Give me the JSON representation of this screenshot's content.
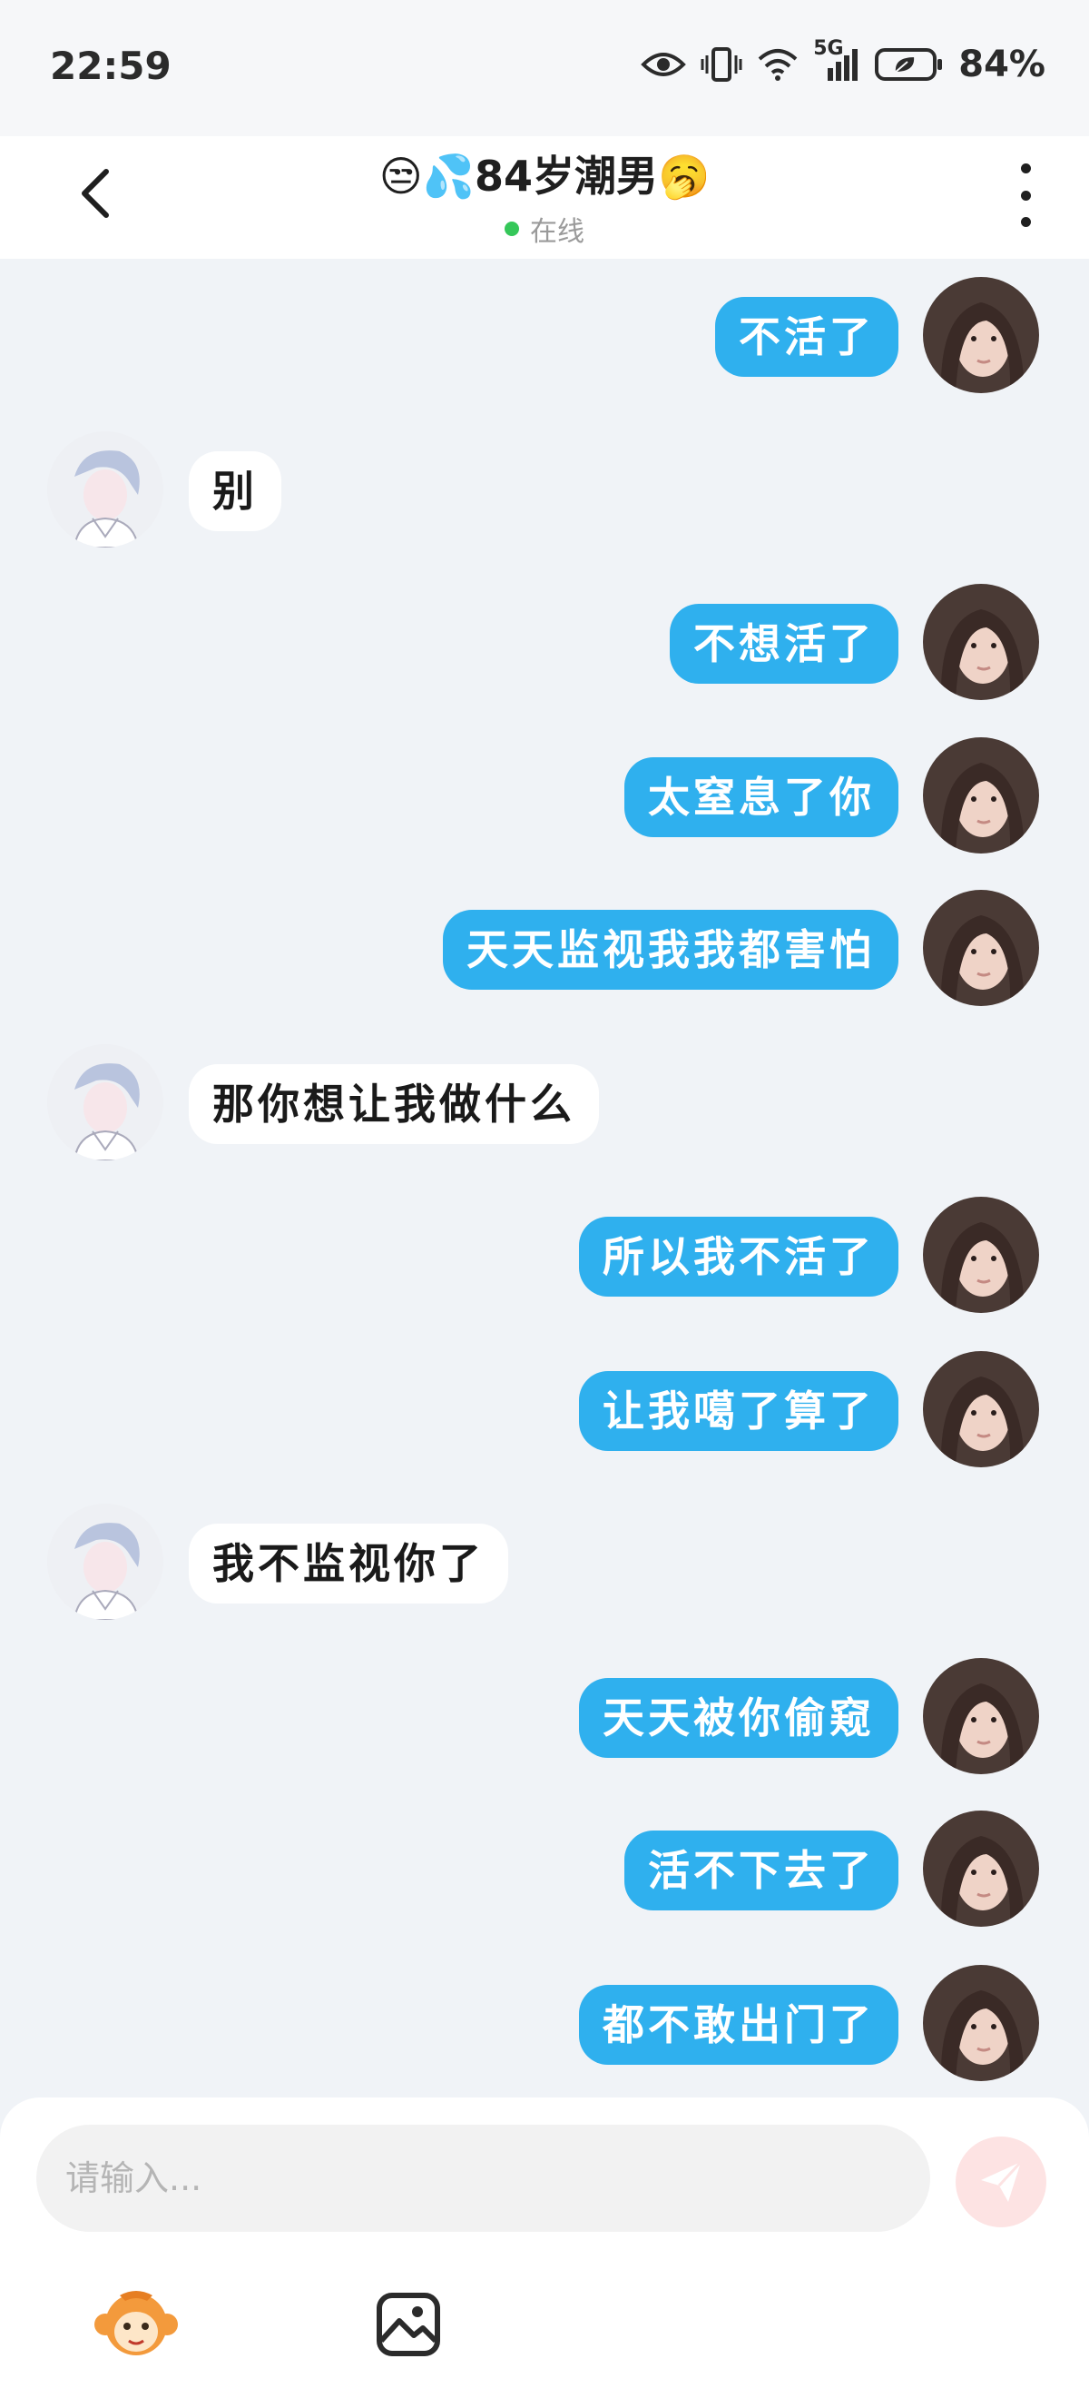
{
  "status_bar": {
    "time": "22:59",
    "signal_label": "5G",
    "battery": "84%"
  },
  "header": {
    "title": "😒💦84岁潮男🥱",
    "status": "在线"
  },
  "messages": [
    {
      "from": "me",
      "text": "不活了"
    },
    {
      "from": "other",
      "text": "别"
    },
    {
      "from": "me",
      "text": "不想活了"
    },
    {
      "from": "me",
      "text": "太窒息了你"
    },
    {
      "from": "me",
      "text": "天天监视我我都害怕"
    },
    {
      "from": "other",
      "text": "那你想让我做什么"
    },
    {
      "from": "me",
      "text": "所以我不活了"
    },
    {
      "from": "me",
      "text": "让我噶了算了"
    },
    {
      "from": "other",
      "text": "我不监视你了"
    },
    {
      "from": "me",
      "text": "天天被你偷窥"
    },
    {
      "from": "me",
      "text": "活不下去了"
    },
    {
      "from": "me",
      "text": "都不敢出门了"
    }
  ],
  "composer": {
    "placeholder": "请输入..."
  },
  "colors": {
    "my_bubble": "#2fb0ee",
    "their_bubble": "#ffffff",
    "online": "#35c759",
    "send_button": "#fde3e3"
  },
  "icons": {
    "back": "chevron-left-icon",
    "more": "more-vertical-icon",
    "send": "send-icon",
    "sticker": "monkey-sticker-icon",
    "image": "image-icon"
  }
}
